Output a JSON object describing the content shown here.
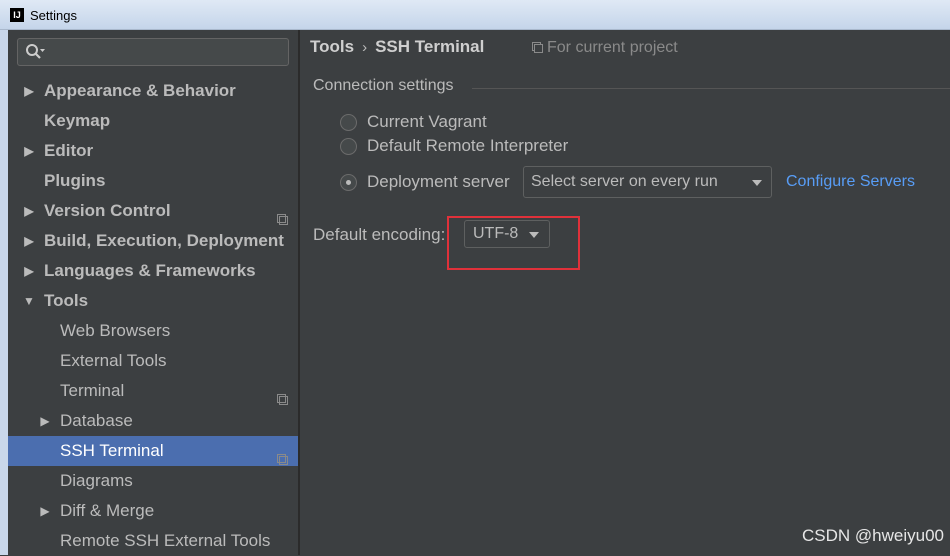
{
  "window": {
    "title": "Settings",
    "app_icon_text": "IJ"
  },
  "sidebar": {
    "search": {
      "placeholder": ""
    },
    "items": [
      {
        "label": "Appearance & Behavior",
        "level": 0,
        "expandable": true,
        "expanded": false,
        "bold": true,
        "project_icon": false
      },
      {
        "label": "Keymap",
        "level": 0,
        "expandable": false,
        "bold": true,
        "project_icon": false
      },
      {
        "label": "Editor",
        "level": 0,
        "expandable": true,
        "expanded": false,
        "bold": true,
        "project_icon": false
      },
      {
        "label": "Plugins",
        "level": 0,
        "expandable": false,
        "bold": true,
        "project_icon": false
      },
      {
        "label": "Version Control",
        "level": 0,
        "expandable": true,
        "expanded": false,
        "bold": true,
        "project_icon": true
      },
      {
        "label": "Build, Execution, Deployment",
        "level": 0,
        "expandable": true,
        "expanded": false,
        "bold": true,
        "project_icon": false
      },
      {
        "label": "Languages & Frameworks",
        "level": 0,
        "expandable": true,
        "expanded": false,
        "bold": true,
        "project_icon": false
      },
      {
        "label": "Tools",
        "level": 0,
        "expandable": true,
        "expanded": true,
        "bold": true,
        "project_icon": false
      },
      {
        "label": "Web Browsers",
        "level": 1,
        "expandable": false,
        "bold": false,
        "project_icon": false
      },
      {
        "label": "External Tools",
        "level": 1,
        "expandable": false,
        "bold": false,
        "project_icon": false
      },
      {
        "label": "Terminal",
        "level": 1,
        "expandable": false,
        "bold": false,
        "project_icon": true
      },
      {
        "label": "Database",
        "level": 1,
        "expandable": true,
        "expanded": false,
        "bold": false,
        "project_icon": false
      },
      {
        "label": "SSH Terminal",
        "level": 1,
        "expandable": false,
        "bold": false,
        "project_icon": true,
        "selected": true
      },
      {
        "label": "Diagrams",
        "level": 1,
        "expandable": false,
        "bold": false,
        "project_icon": false
      },
      {
        "label": "Diff & Merge",
        "level": 1,
        "expandable": true,
        "expanded": false,
        "bold": false,
        "project_icon": false
      },
      {
        "label": "Remote SSH External Tools",
        "level": 1,
        "expandable": false,
        "bold": false,
        "project_icon": false
      }
    ]
  },
  "main": {
    "breadcrumb": {
      "parent": "Tools",
      "separator": "›",
      "current": "SSH Terminal"
    },
    "for_current_project": "For current project",
    "connection": {
      "title": "Connection settings",
      "options": [
        {
          "label": "Current Vagrant",
          "checked": false
        },
        {
          "label": "Default Remote Interpreter",
          "checked": false
        },
        {
          "label": "Deployment server",
          "checked": true
        }
      ],
      "server_select": "Select server on every run",
      "configure_link": "Configure Servers"
    },
    "encoding": {
      "label": "Default encoding:",
      "value": "UTF-8"
    }
  },
  "watermark": "CSDN @hweiyu00",
  "colors": {
    "background": "#3c3f41",
    "selection": "#4b6eaf",
    "link": "#589df6",
    "highlight_box": "#e0313a",
    "text": "#bbbbbb"
  }
}
